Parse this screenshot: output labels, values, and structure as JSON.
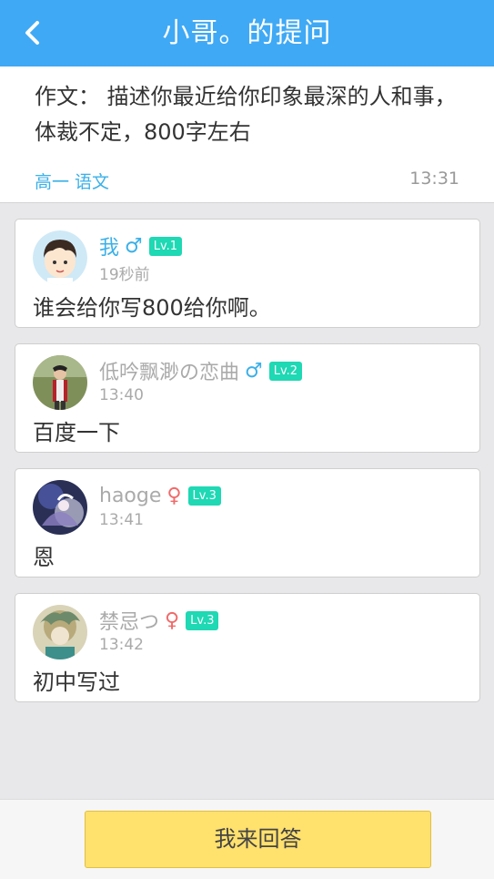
{
  "header": {
    "back_icon": "chevron-left-icon",
    "title": "小哥。的提问"
  },
  "question": {
    "text": "作文：  描述你最近给你印象最深的人和事，体裁不定，800字左右",
    "subject": "高一 语文",
    "time": "13:31"
  },
  "answers": [
    {
      "name": "我",
      "gender": "♂",
      "level": "Lv.1",
      "time": "19秒前",
      "content": "谁会给你写800给你啊。"
    },
    {
      "name": "低吟飘渺の恋曲",
      "gender": "♂",
      "level": "Lv.2",
      "time": "13:40",
      "content": "百度一下"
    },
    {
      "name": "haoge",
      "gender": "♀",
      "level": "Lv.3",
      "time": "13:41",
      "content": "恩"
    },
    {
      "name": "禁忌つ",
      "gender": "♀",
      "level": "Lv.3",
      "time": "13:42",
      "content": "初中写过"
    }
  ],
  "bottom": {
    "answer_button": "我来回答"
  },
  "colors": {
    "header_bg": "#3fa9f5",
    "accent_blue": "#3bb0e8",
    "level_badge": "#1fd8b4",
    "answer_button_bg": "#ffe16e",
    "female": "#f06a6a"
  }
}
